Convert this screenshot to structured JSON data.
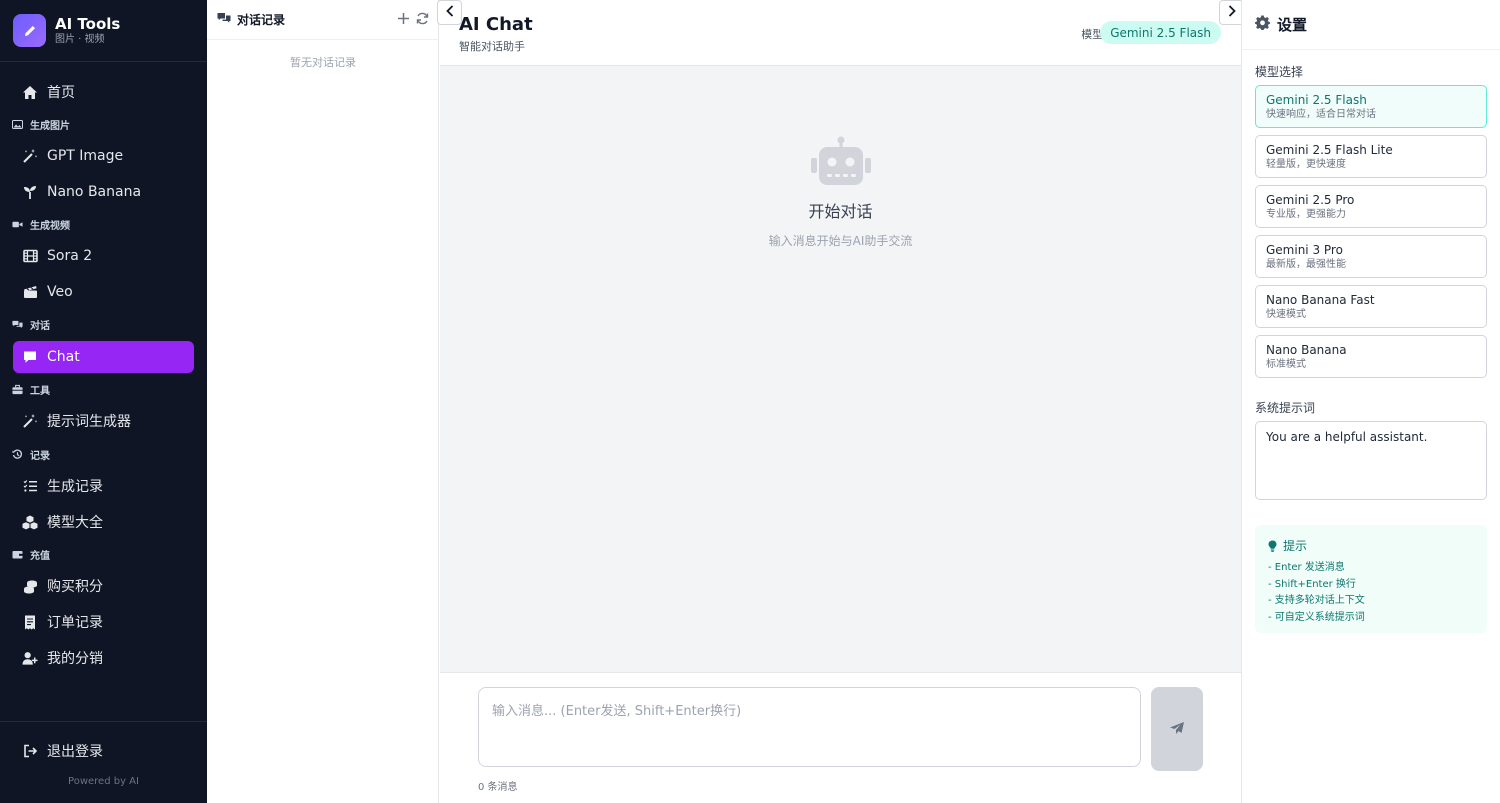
{
  "brand": {
    "title": "AI Tools",
    "subtitle": "图片 · 视频"
  },
  "nav": {
    "home": "首页",
    "sec_image": "生成图片",
    "gpt_image": "GPT Image",
    "nano_banana": "Nano Banana",
    "sec_video": "生成视频",
    "sora": "Sora 2",
    "veo": "Veo",
    "sec_chat": "对话",
    "chat": "Chat",
    "sec_tools": "工具",
    "prompt_gen": "提示词生成器",
    "sec_records": "记录",
    "gen_records": "生成记录",
    "models": "模型大全",
    "sec_recharge": "充值",
    "buy_credits": "购买积分",
    "orders": "订单记录",
    "distribution": "我的分销",
    "logout": "退出登录",
    "powered": "Powered by AI",
    "active_color": "#9526f4"
  },
  "conversations": {
    "title": "对话记录",
    "empty": "暂无对话记录"
  },
  "main": {
    "title": "AI Chat",
    "subtitle": "智能对话助手",
    "model_label": "模型:",
    "model_value": "Gemini 2.5 Flash",
    "empty_title": "开始对话",
    "empty_sub": "输入消息开始与AI助手交流",
    "input_placeholder": "输入消息... (Enter发送, Shift+Enter换行)",
    "message_count": "0 条消息"
  },
  "settings": {
    "title": "设置",
    "model_section": "模型选择",
    "models": [
      {
        "name": "Gemini 2.5 Flash",
        "desc": "快速响应，适合日常对话"
      },
      {
        "name": "Gemini 2.5 Flash Lite",
        "desc": "轻量版，更快速度"
      },
      {
        "name": "Gemini 2.5 Pro",
        "desc": "专业版，更强能力"
      },
      {
        "name": "Gemini 3 Pro",
        "desc": "最新版，最强性能"
      },
      {
        "name": "Nano Banana Fast",
        "desc": "快速模式"
      },
      {
        "name": "Nano Banana",
        "desc": "标准模式"
      }
    ],
    "system_prompt_label": "系统提示词",
    "system_prompt_value": "You are a helpful assistant.",
    "tips_title": "提示",
    "tips": [
      "- Enter 发送消息",
      "- Shift+Enter 换行",
      "- 支持多轮对话上下文",
      "- 可自定义系统提示词"
    ]
  }
}
